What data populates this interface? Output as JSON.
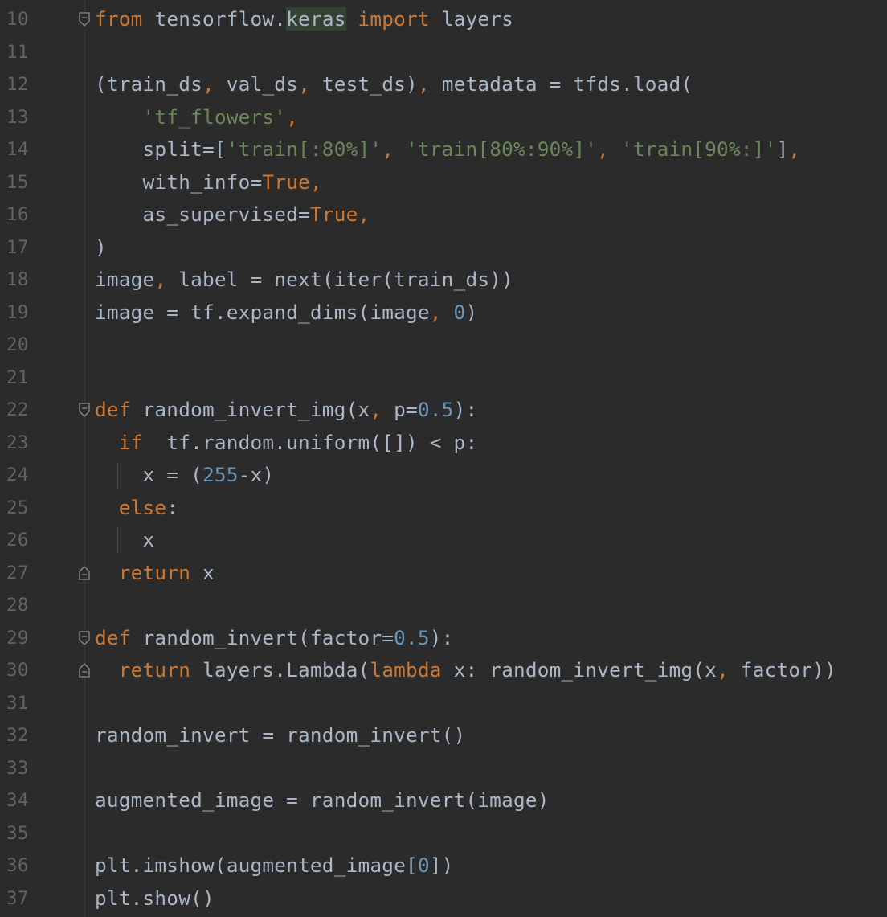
{
  "editor": {
    "language": "python",
    "colors": {
      "background": "#2b2b2b",
      "text": "#a9b7c6",
      "keyword": "#cc7832",
      "string": "#6a8759",
      "number": "#6897bb",
      "line_number": "#5f6366"
    },
    "lines": [
      {
        "number": "10",
        "tokens": [
          {
            "t": "from",
            "c": "kw"
          },
          {
            "t": " tensorflow."
          },
          {
            "t": "keras",
            "c": "hl"
          },
          {
            "t": " "
          },
          {
            "t": "import",
            "c": "kw"
          },
          {
            "t": " layers"
          }
        ]
      },
      {
        "number": "11",
        "tokens": []
      },
      {
        "number": "12",
        "tokens": [
          {
            "t": "(train_ds"
          },
          {
            "t": ",",
            "c": "sym"
          },
          {
            "t": " val_ds"
          },
          {
            "t": ",",
            "c": "sym"
          },
          {
            "t": " test_ds)"
          },
          {
            "t": ",",
            "c": "sym"
          },
          {
            "t": " metadata = tfds.load("
          }
        ]
      },
      {
        "number": "13",
        "tokens": [
          {
            "t": "    "
          },
          {
            "t": "'tf_flowers'",
            "c": "str"
          },
          {
            "t": ",",
            "c": "sym"
          }
        ]
      },
      {
        "number": "14",
        "tokens": [
          {
            "t": "    split=["
          },
          {
            "t": "'train[:80%]'",
            "c": "str"
          },
          {
            "t": ",",
            "c": "sym"
          },
          {
            "t": " "
          },
          {
            "t": "'train[80%:90%]'",
            "c": "str"
          },
          {
            "t": ",",
            "c": "sym"
          },
          {
            "t": " "
          },
          {
            "t": "'train[90%:]'",
            "c": "str"
          },
          {
            "t": "]"
          },
          {
            "t": ",",
            "c": "sym"
          }
        ]
      },
      {
        "number": "15",
        "tokens": [
          {
            "t": "    with_info="
          },
          {
            "t": "True",
            "c": "kw"
          },
          {
            "t": ",",
            "c": "sym"
          }
        ]
      },
      {
        "number": "16",
        "tokens": [
          {
            "t": "    as_supervised="
          },
          {
            "t": "True",
            "c": "kw"
          },
          {
            "t": ",",
            "c": "sym"
          }
        ]
      },
      {
        "number": "17",
        "tokens": [
          {
            "t": ")"
          }
        ]
      },
      {
        "number": "18",
        "tokens": [
          {
            "t": "image"
          },
          {
            "t": ",",
            "c": "sym"
          },
          {
            "t": " label = next(iter(train_ds))"
          }
        ]
      },
      {
        "number": "19",
        "tokens": [
          {
            "t": "image = tf.expand_dims(image"
          },
          {
            "t": ",",
            "c": "sym"
          },
          {
            "t": " "
          },
          {
            "t": "0",
            "c": "num"
          },
          {
            "t": ")"
          }
        ]
      },
      {
        "number": "20",
        "tokens": []
      },
      {
        "number": "21",
        "tokens": []
      },
      {
        "number": "22",
        "tokens": [
          {
            "t": "def",
            "c": "kw"
          },
          {
            "t": " random_invert_img(x"
          },
          {
            "t": ",",
            "c": "sym"
          },
          {
            "t": " p="
          },
          {
            "t": "0.5",
            "c": "num"
          },
          {
            "t": "):"
          }
        ]
      },
      {
        "number": "23",
        "tokens": [
          {
            "t": "  "
          },
          {
            "t": "if",
            "c": "kw"
          },
          {
            "t": "  tf.random.uniform([]) < p:"
          }
        ]
      },
      {
        "number": "24",
        "tokens": [
          {
            "t": "    x = ("
          },
          {
            "t": "255",
            "c": "num"
          },
          {
            "t": "-x)"
          }
        ]
      },
      {
        "number": "25",
        "tokens": [
          {
            "t": "  "
          },
          {
            "t": "else",
            "c": "kw"
          },
          {
            "t": ":"
          }
        ]
      },
      {
        "number": "26",
        "tokens": [
          {
            "t": "    x"
          }
        ]
      },
      {
        "number": "27",
        "tokens": [
          {
            "t": "  "
          },
          {
            "t": "return",
            "c": "kw"
          },
          {
            "t": " x"
          }
        ]
      },
      {
        "number": "28",
        "tokens": []
      },
      {
        "number": "29",
        "tokens": [
          {
            "t": "def",
            "c": "kw"
          },
          {
            "t": " random_invert(factor="
          },
          {
            "t": "0.5",
            "c": "num"
          },
          {
            "t": "):"
          }
        ]
      },
      {
        "number": "30",
        "tokens": [
          {
            "t": "  "
          },
          {
            "t": "return",
            "c": "kw"
          },
          {
            "t": " layers.Lambda("
          },
          {
            "t": "lambda",
            "c": "kw"
          },
          {
            "t": " x: random_invert_img(x"
          },
          {
            "t": ",",
            "c": "sym"
          },
          {
            "t": " factor))"
          }
        ]
      },
      {
        "number": "31",
        "tokens": []
      },
      {
        "number": "32",
        "tokens": [
          {
            "t": "random_invert = random_invert()"
          }
        ]
      },
      {
        "number": "33",
        "tokens": []
      },
      {
        "number": "34",
        "tokens": [
          {
            "t": "augmented_image = random_invert(image)"
          }
        ]
      },
      {
        "number": "35",
        "tokens": []
      },
      {
        "number": "36",
        "tokens": [
          {
            "t": "plt.imshow(augmented_image["
          },
          {
            "t": "0",
            "c": "num"
          },
          {
            "t": "])"
          }
        ]
      },
      {
        "number": "37",
        "tokens": [
          {
            "t": "plt.show()"
          }
        ]
      }
    ],
    "fold_markers": [
      {
        "line": "10",
        "kind": "fold-start-icon"
      },
      {
        "line": "22",
        "kind": "fold-start-icon"
      },
      {
        "line": "27",
        "kind": "fold-end-icon"
      },
      {
        "line": "29",
        "kind": "fold-start-icon"
      },
      {
        "line": "30",
        "kind": "fold-end-icon"
      }
    ]
  }
}
